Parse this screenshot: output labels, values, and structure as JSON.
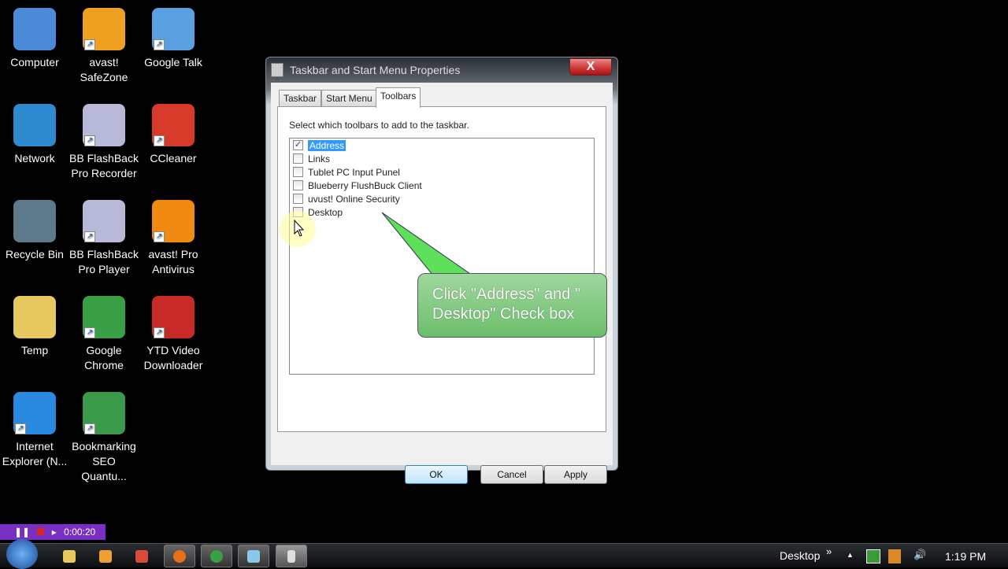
{
  "desktop": {
    "icons": [
      {
        "label": "Computer",
        "color": "#4a8ad8"
      },
      {
        "label": "avast! SafeZone",
        "color": "#f0a020"
      },
      {
        "label": "Google Talk",
        "color": "#5aa0e0"
      },
      {
        "label": "Network",
        "color": "#2f8ad0"
      },
      {
        "label": "BB FlashBack Pro Recorder",
        "color": "#b8b8d8"
      },
      {
        "label": "CCleaner",
        "color": "#d83a2a"
      },
      {
        "label": "Recycle Bin",
        "color": "#5c7a8a"
      },
      {
        "label": "BB FlashBack Pro Player",
        "color": "#b8b8d8"
      },
      {
        "label": "avast! Pro Antivirus",
        "color": "#f08a10"
      },
      {
        "label": "Temp",
        "color": "#e8c860"
      },
      {
        "label": "Google Chrome",
        "color": "#3aa048"
      },
      {
        "label": "YTD Video Downloader",
        "color": "#c82a2a"
      },
      {
        "label": "Internet Explorer (N...",
        "color": "#2a8ae0"
      },
      {
        "label": "Bookmarking SEO Quantu...",
        "color": "#3a9a4a"
      }
    ]
  },
  "dialog": {
    "title": "Taskbar and Start Menu Properties",
    "close": "X",
    "tabs": [
      "Taskbar",
      "Start Menu",
      "Toolbars"
    ],
    "instruction": "Select which toolbars to add to the taskbar.",
    "items": [
      {
        "label": "Address",
        "checked": true
      },
      {
        "label": "Links",
        "checked": false
      },
      {
        "label": "Tublet PC Input Punel",
        "checked": false
      },
      {
        "label": "Blueberry FlushBuck Client",
        "checked": false
      },
      {
        "label": "uvust! Online Security",
        "checked": false
      },
      {
        "label": "Desktop",
        "checked": false
      }
    ],
    "check_mark": "✓",
    "buttons": {
      "ok": "OK",
      "cancel": "Cancel",
      "apply": "Apply"
    }
  },
  "callout": {
    "text": "Click \"Address\" and \" Desktop\" Check box"
  },
  "recorder": {
    "time": "0:00:20"
  },
  "taskbar": {
    "toolbar_label": "Desktop",
    "chevron": "»",
    "tray_arrow": "▲",
    "volume": "🔊",
    "clock": "1:19 PM"
  }
}
